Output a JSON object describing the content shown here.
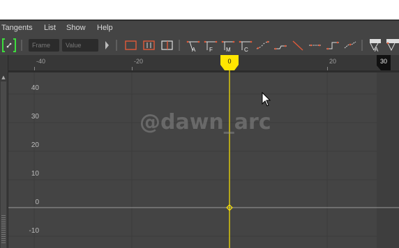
{
  "menu": [
    "Tangents",
    "List",
    "Show",
    "Help"
  ],
  "toolbar": {
    "frame_placeholder": "Frame",
    "value_placeholder": "Value",
    "tangent_letters": [
      "A",
      "F",
      "M",
      "C"
    ],
    "last_icon_letter": "A"
  },
  "ruler": {
    "labels": [
      "-40",
      "-20",
      "20"
    ],
    "current_time": "0",
    "end_frame": "30"
  },
  "graph": {
    "y_labels": [
      "40",
      "30",
      "20",
      "10",
      "0",
      "-10"
    ]
  },
  "watermark": "@dawn_arc",
  "colors": {
    "timeline_marker": "#ffe600",
    "background": "#444444",
    "grid": "#3a3a3a"
  }
}
